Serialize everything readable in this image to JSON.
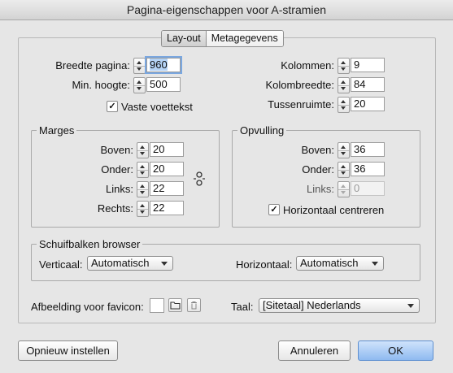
{
  "window": {
    "title": "Pagina-eigenschappen voor A-stramien"
  },
  "tabs": [
    {
      "label": "Lay-out",
      "active": true
    },
    {
      "label": "Metagegevens",
      "active": false
    }
  ],
  "page": {
    "width_label": "Breedte pagina:",
    "width_value": "960",
    "min_height_label": "Min. hoogte:",
    "min_height_value": "500",
    "fixed_footer_label": "Vaste voettekst",
    "fixed_footer_checked": true
  },
  "columns": {
    "count_label": "Kolommen:",
    "count_value": "9",
    "width_label": "Kolombreedte:",
    "width_value": "84",
    "gutter_label": "Tussenruimte:",
    "gutter_value": "20"
  },
  "margins": {
    "title": "Marges",
    "top_label": "Boven:",
    "top_value": "20",
    "bottom_label": "Onder:",
    "bottom_value": "20",
    "left_label": "Links:",
    "left_value": "22",
    "right_label": "Rechts:",
    "right_value": "22"
  },
  "padding": {
    "title": "Opvulling",
    "top_label": "Boven:",
    "top_value": "36",
    "bottom_label": "Onder:",
    "bottom_value": "36",
    "left_label": "Links:",
    "left_value": "0",
    "center_label": "Horizontaal centreren",
    "center_checked": true
  },
  "scrollbars": {
    "title": "Schuifbalken browser",
    "vertical_label": "Verticaal:",
    "vertical_value": "Automatisch",
    "horizontal_label": "Horizontaal:",
    "horizontal_value": "Automatisch"
  },
  "favicon": {
    "label": "Afbeelding voor favicon:"
  },
  "language": {
    "label": "Taal:",
    "value": "[Sitetaal] Nederlands"
  },
  "buttons": {
    "reset": "Opnieuw instellen",
    "cancel": "Annuleren",
    "ok": "OK"
  },
  "icons": [
    "link-icon",
    "folder-icon",
    "trash-icon",
    "checkmark-icon"
  ]
}
